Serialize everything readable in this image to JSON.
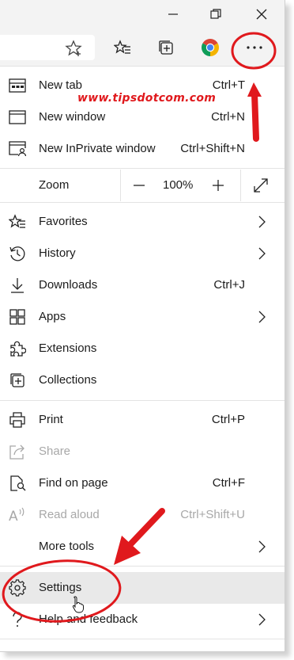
{
  "watermark": "www.tipsdotcom.com",
  "toolbar": {
    "star_icon": "star-outline-icon",
    "favorites_icon": "favorites-icon",
    "collections_icon": "collections-icon",
    "profile_icon": "chrome-logo-icon",
    "menu_icon": "more-dots-icon"
  },
  "menu": {
    "new_tab": {
      "label": "New tab",
      "shortcut": "Ctrl+T"
    },
    "new_window": {
      "label": "New window",
      "shortcut": "Ctrl+N"
    },
    "new_inprivate": {
      "label": "New InPrivate window",
      "shortcut": "Ctrl+Shift+N"
    },
    "zoom": {
      "label": "Zoom",
      "minus": "—",
      "value": "100%",
      "plus": "+"
    },
    "favorites": {
      "label": "Favorites"
    },
    "history": {
      "label": "History"
    },
    "downloads": {
      "label": "Downloads",
      "shortcut": "Ctrl+J"
    },
    "apps": {
      "label": "Apps"
    },
    "extensions": {
      "label": "Extensions"
    },
    "collections": {
      "label": "Collections"
    },
    "print": {
      "label": "Print",
      "shortcut": "Ctrl+P"
    },
    "share": {
      "label": "Share"
    },
    "find": {
      "label": "Find on page",
      "shortcut": "Ctrl+F"
    },
    "read_aloud": {
      "label": "Read aloud",
      "shortcut": "Ctrl+Shift+U"
    },
    "more_tools": {
      "label": "More tools"
    },
    "settings": {
      "label": "Settings"
    },
    "help": {
      "label": "Help and feedback"
    }
  },
  "colors": {
    "annotation_red": "#e0191d",
    "menu_bg": "#ffffff",
    "chrome_bg": "#f3f3f3",
    "disabled_text": "#a8a8a8",
    "hover_bg": "#e9e9e9"
  }
}
